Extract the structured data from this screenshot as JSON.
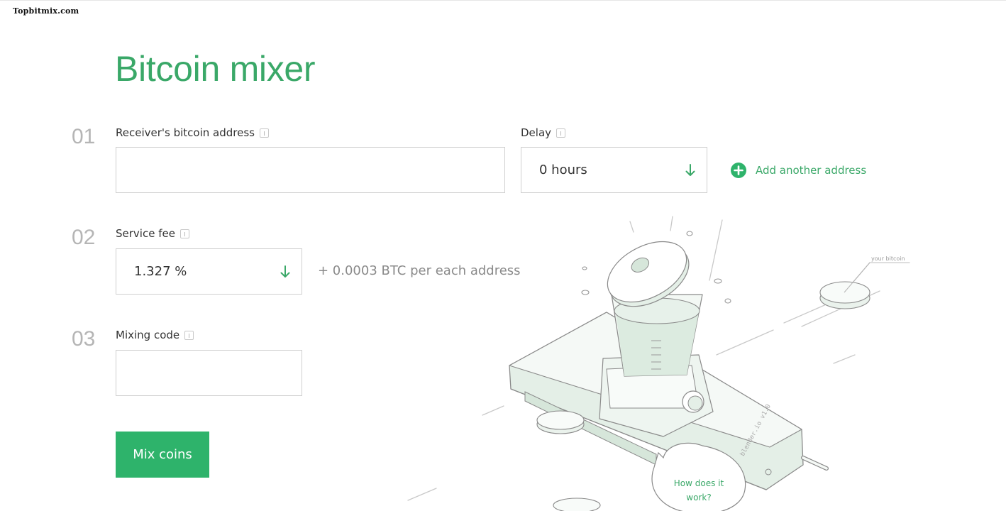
{
  "watermark": "Topbitmix.com",
  "page_title": "Bitcoin mixer",
  "steps": [
    {
      "number": "01",
      "label": "Receiver's bitcoin address"
    },
    {
      "number": "02",
      "label": "Service fee"
    },
    {
      "number": "03",
      "label": "Mixing code"
    }
  ],
  "address_input": {
    "value": "",
    "placeholder": ""
  },
  "delay": {
    "label": "Delay",
    "value": "0 hours"
  },
  "add_address": {
    "label": "Add another address"
  },
  "service_fee": {
    "value": "1.327 %",
    "extra": "+ 0.0003 BTC per each address"
  },
  "mixing_code_input": {
    "value": "",
    "placeholder": ""
  },
  "mix_button": {
    "label": "Mix coins"
  },
  "illustration": {
    "coin_label": "your bitcoin",
    "device_label": "blender.io v1.0",
    "how_it_works": [
      "How does it",
      "work?"
    ]
  },
  "colors": {
    "accent": "#3aa868",
    "button": "#2eb36b",
    "step_number": "#b5b5b5",
    "border": "#cfcfcf",
    "illustration_fill": "#e4efe7"
  },
  "icons": {
    "info": "info-icon",
    "select_arrow": "arrow-down-icon",
    "add": "plus-circle-icon"
  }
}
